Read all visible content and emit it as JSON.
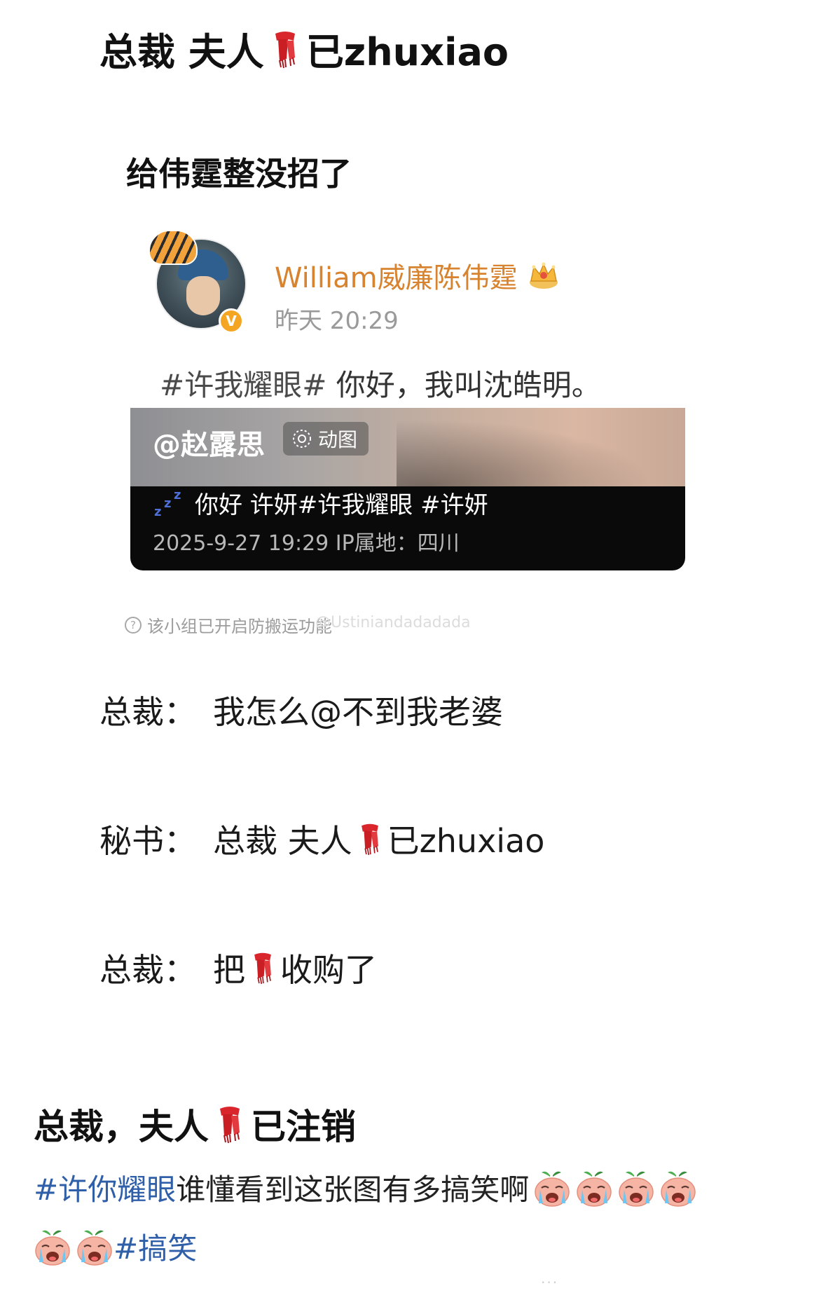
{
  "header": {
    "title_prefix": "总裁 夫人",
    "title_suffix": "已zhuxiao",
    "subtitle": "给伟霆整没招了"
  },
  "post": {
    "author": "William威廉陈伟霆",
    "time": "昨天 20:29",
    "hashtag": "#许我耀眼#",
    "text": " 你好，我叫沈皓明。",
    "badge": "V",
    "embed": {
      "mention": "@赵露思",
      "gif_label": "动图",
      "caption": "你好 许妍#许我耀眼 #许妍",
      "meta": "2025-9-27 19:29 IP属地：四川"
    }
  },
  "notice": {
    "text": "该小组已开启防搬运功能",
    "watermark": "@Ustiniandadadada"
  },
  "dialog": [
    {
      "speaker": "总裁：",
      "line": "我怎么@不到我老婆"
    },
    {
      "speaker": "秘书：",
      "line_prefix": "总裁 夫人",
      "line_suffix": "已zhuxiao"
    },
    {
      "speaker": "总裁：",
      "line_prefix": "把",
      "line_suffix": "收购了"
    }
  ],
  "footer": {
    "title_prefix": "总裁，夫人",
    "title_suffix": "已注销",
    "hashtag1": "#许你耀眼",
    "text1": " 谁懂看到这张图有多搞笑啊",
    "hashtag2": "#搞笑",
    "more": "···"
  },
  "icons": [
    "scarf-icon",
    "crown-icon",
    "gif-icon",
    "zzz-icon",
    "question-icon",
    "crying-face-icon"
  ],
  "colors": {
    "author": "#d7832f",
    "hashtag": "#2f5fa8",
    "verified": "#f4a623"
  }
}
